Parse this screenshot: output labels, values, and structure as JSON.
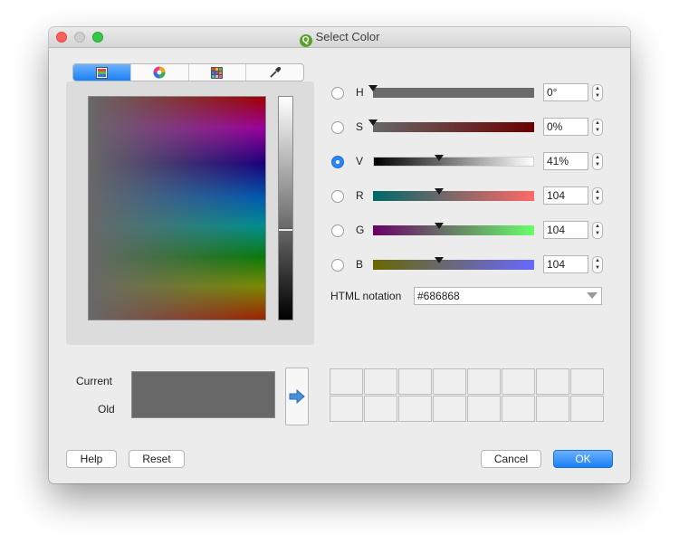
{
  "window": {
    "title": "Select Color"
  },
  "tabs": [
    {
      "name": "color-box-icon",
      "active": true
    },
    {
      "name": "color-wheel-icon",
      "active": false
    },
    {
      "name": "swatch-grid-icon",
      "active": false
    },
    {
      "name": "eyedropper-icon",
      "active": false
    }
  ],
  "channels": {
    "hue": {
      "label": "H",
      "value": "0°",
      "level": 0
    },
    "saturation": {
      "label": "S",
      "value": "0%",
      "level": 0
    },
    "value": {
      "label": "V",
      "value": "41%",
      "level": 0.41,
      "selected": true
    },
    "red": {
      "label": "R",
      "value": "104",
      "level": 0.41
    },
    "green": {
      "label": "G",
      "value": "104",
      "level": 0.41
    },
    "blue": {
      "label": "B",
      "value": "104",
      "level": 0.41
    }
  },
  "html_notation": {
    "label": "HTML notation",
    "value": "#686868"
  },
  "preview": {
    "current_label": "Current",
    "old_label": "Old",
    "color": "#686868"
  },
  "buttons": {
    "help": "Help",
    "reset": "Reset",
    "cancel": "Cancel",
    "ok": "OK"
  },
  "colors": {
    "accent": "#1a80f8",
    "current_color": "#686868"
  }
}
